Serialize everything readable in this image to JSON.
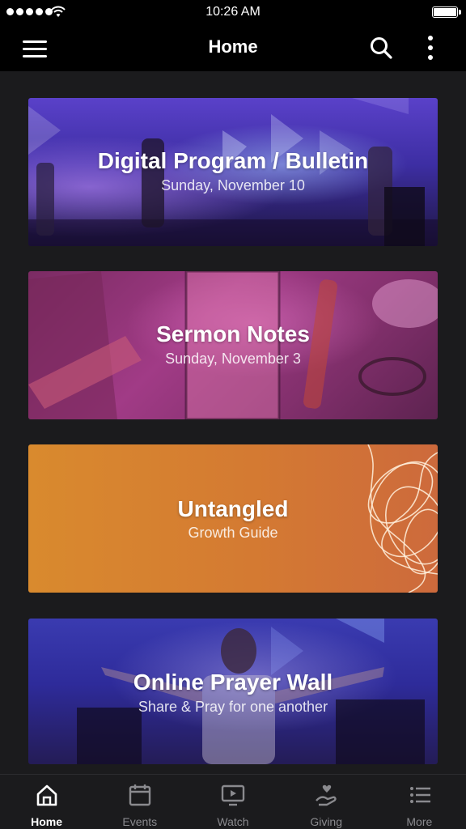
{
  "status_bar": {
    "time": "10:26 AM"
  },
  "nav": {
    "title": "Home"
  },
  "cards": [
    {
      "title": "Digital Program / Bulletin",
      "subtitle": "Sunday, November 10"
    },
    {
      "title": "Sermon Notes",
      "subtitle": "Sunday, November 3"
    },
    {
      "title": "Untangled",
      "subtitle": "Growth Guide"
    },
    {
      "title": "Online Prayer Wall",
      "subtitle": "Share & Pray for one another"
    }
  ],
  "tabs": [
    {
      "label": "Home",
      "icon": "home-icon",
      "active": true
    },
    {
      "label": "Events",
      "icon": "calendar-icon",
      "active": false
    },
    {
      "label": "Watch",
      "icon": "play-screen-icon",
      "active": false
    },
    {
      "label": "Giving",
      "icon": "giving-hand-icon",
      "active": false
    },
    {
      "label": "More",
      "icon": "list-icon",
      "active": false
    }
  ],
  "colors": {
    "active_tab": "#ffffff",
    "inactive_tab": "#8a8a8e",
    "background": "#1b1b1d"
  }
}
